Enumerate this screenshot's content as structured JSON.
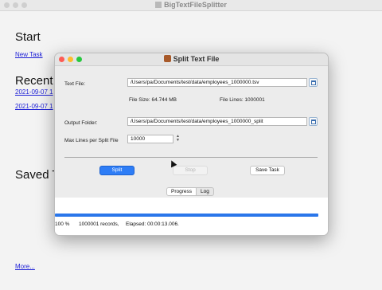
{
  "main_window": {
    "title": "BigTextFileSplitter",
    "start_heading": "Start",
    "new_task_link": "New Task",
    "recent_heading": "Recent",
    "recent_items": [
      "2021-09-07 1",
      "2021-09-07 1"
    ],
    "saved_heading": "Saved T",
    "more_link": "More..."
  },
  "dialog": {
    "title": "Split Text File",
    "text_file_label": "Text File:",
    "text_file_value": "/Users/pa/Documents/test/data/employees_1000000.tsv",
    "file_size_text": "File Size: 64.744 MB",
    "file_lines_text": "File Lines: 1000001",
    "output_folder_label": "Output Folder:",
    "output_folder_value": "/Users/pa/Documents/test/data/employees_1000000_split",
    "max_lines_label": "Max Lines per Split File",
    "max_lines_value": "10000",
    "split_button": "Split",
    "stop_button": "Stop",
    "save_task_button": "Save Task",
    "tabs": [
      "Progress",
      "Log"
    ],
    "progress_fraction": 1.0,
    "status_percent": "100 %",
    "status_records": "1000001 records,",
    "status_elapsed": "Elapsed: 00:00:13.006."
  },
  "icons": {
    "browse": "calendar-icon",
    "stepper": "chevron-updown-icon",
    "cursor": "mouse-cursor-icon"
  },
  "colors": {
    "primary_button": "#2e7df6",
    "progress_bar": "#2a76ea",
    "link": "#1d1fd6"
  }
}
